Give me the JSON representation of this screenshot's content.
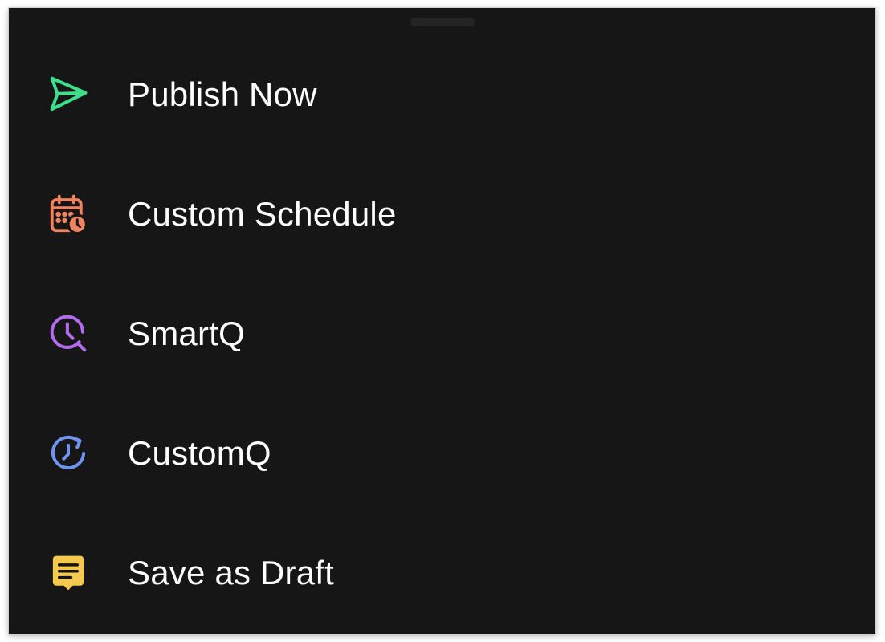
{
  "sheet": {
    "background": "#161616",
    "handle_color": "#242424"
  },
  "menu": {
    "items": [
      {
        "label": "Publish Now",
        "icon": "send-icon",
        "color": "#3de08a"
      },
      {
        "label": "Custom Schedule",
        "icon": "calendar-clock-icon",
        "color": "#f0845f"
      },
      {
        "label": "SmartQ",
        "icon": "clock-search-icon",
        "color": "#b36cf0"
      },
      {
        "label": "CustomQ",
        "icon": "clock-refresh-icon",
        "color": "#6f93f0"
      },
      {
        "label": "Save as Draft",
        "icon": "draft-note-icon",
        "color": "#f5c94e"
      }
    ]
  }
}
